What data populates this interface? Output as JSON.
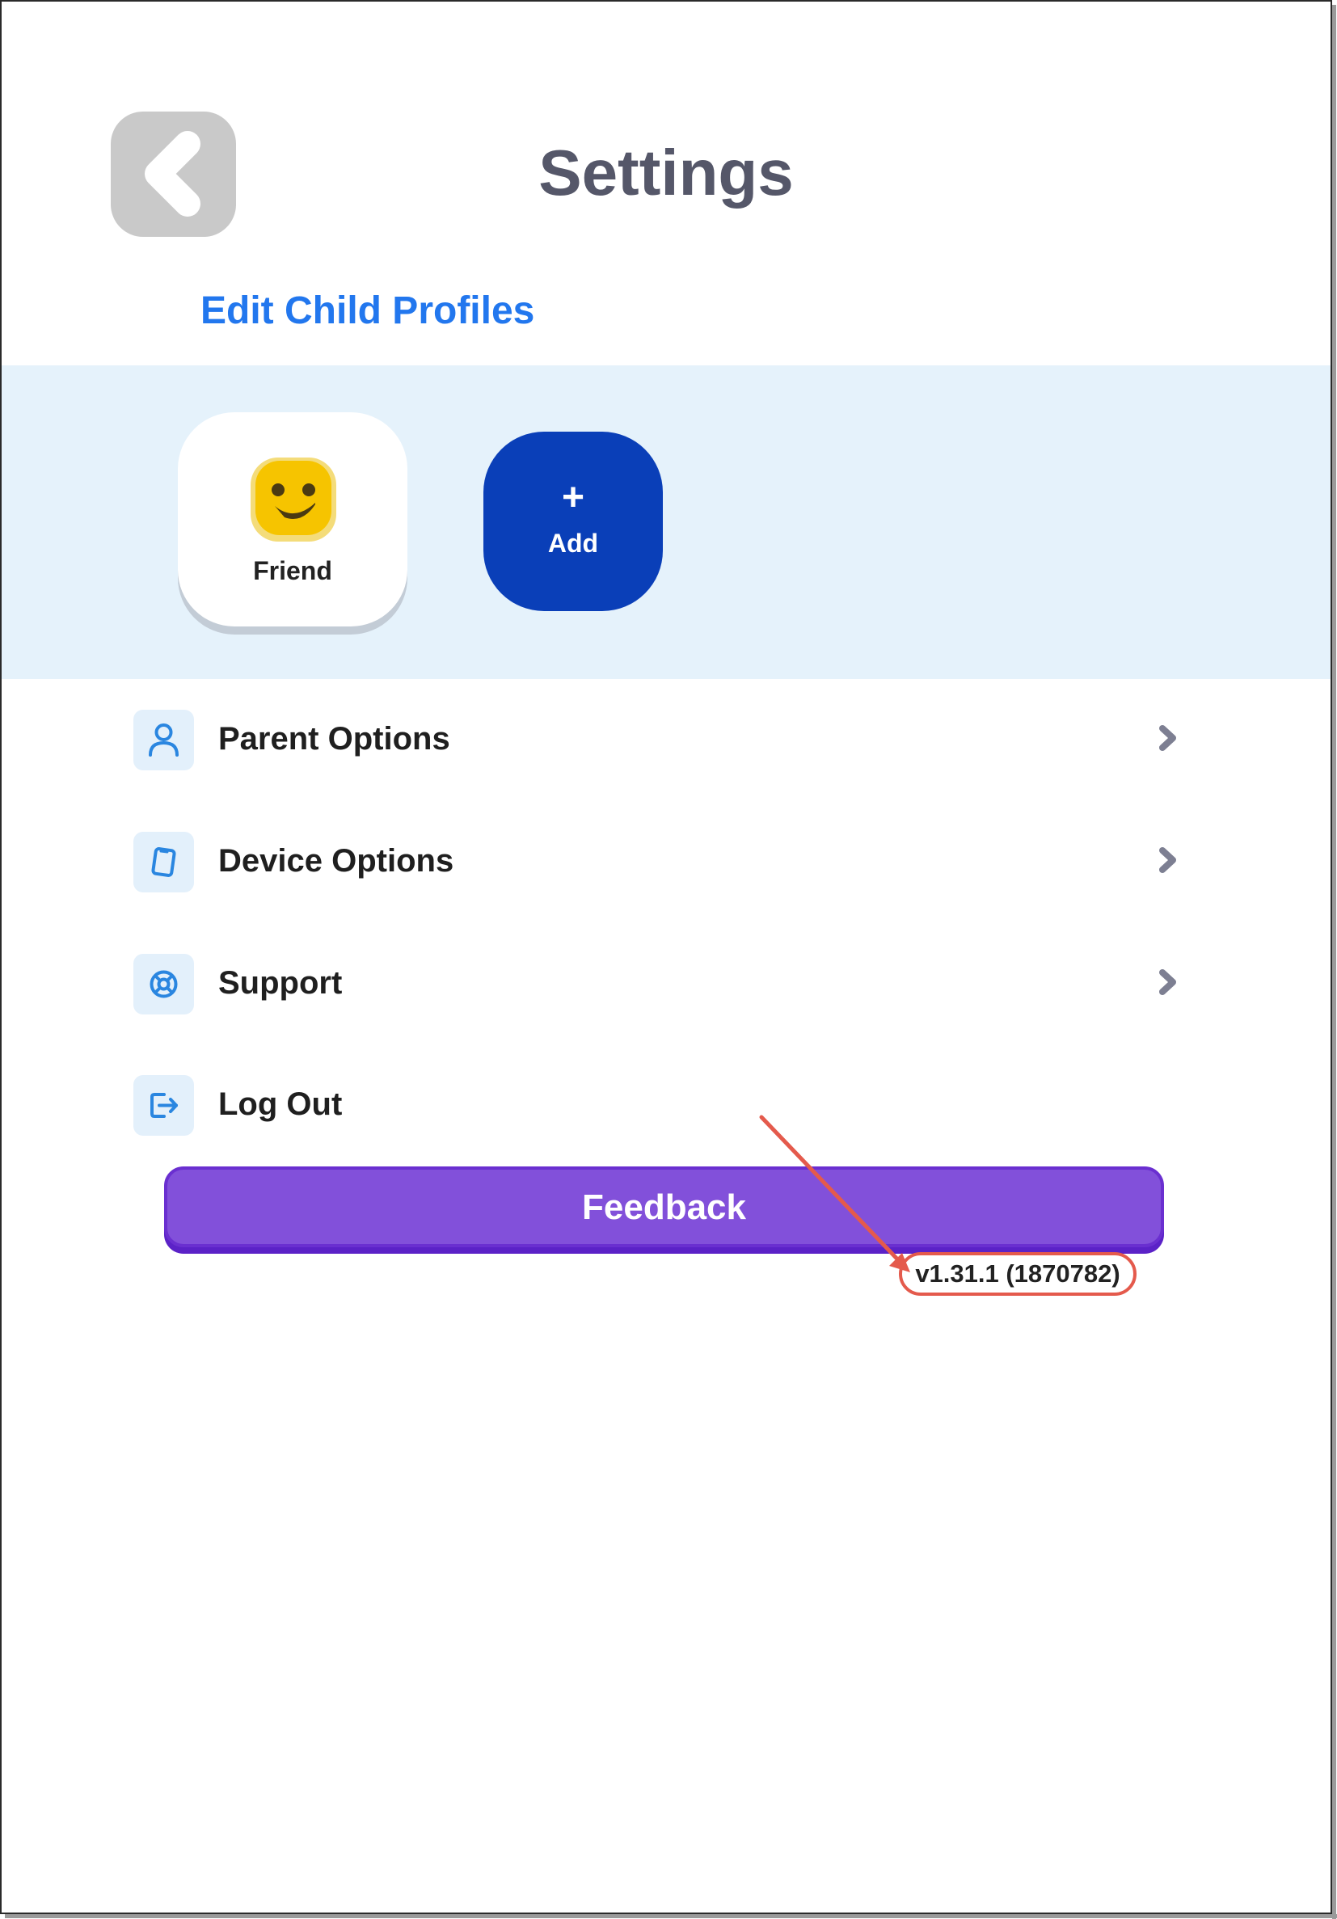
{
  "header": {
    "title": "Settings"
  },
  "profiles": {
    "edit_link": "Edit Child Profiles",
    "items": [
      {
        "name": "Friend"
      }
    ],
    "add_icon": "+",
    "add_label": "Add"
  },
  "menu": {
    "items": [
      {
        "label": "Parent Options",
        "icon": "person-icon"
      },
      {
        "label": "Device Options",
        "icon": "tablet-icon"
      },
      {
        "label": "Support",
        "icon": "lifebuoy-icon"
      },
      {
        "label": "Log Out",
        "icon": "logout-icon"
      }
    ]
  },
  "feedback": {
    "label": "Feedback"
  },
  "version": "v1.31.1 (1870782)",
  "colors": {
    "accent_blue": "#2277ee",
    "add_button": "#0a3fb8",
    "feedback_purple": "#8250da",
    "profiles_band": "#e5f2fb",
    "annotation_red": "#e45a4c"
  }
}
